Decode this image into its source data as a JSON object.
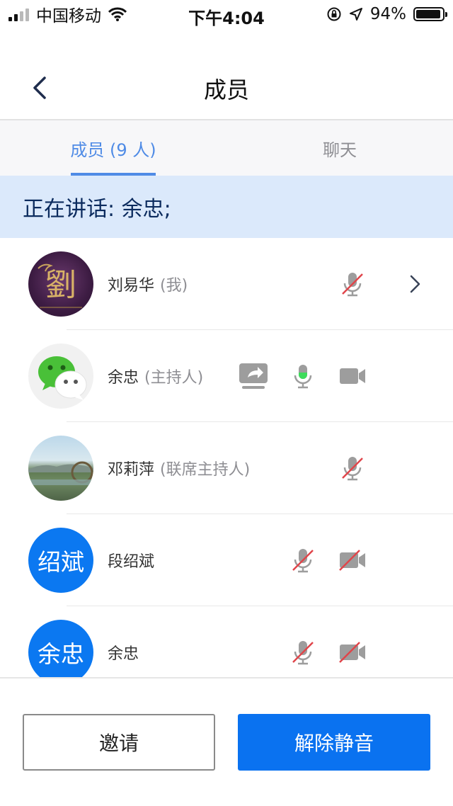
{
  "status_bar": {
    "carrier": "中国移动",
    "time": "下午4:04",
    "battery_percent": "94%",
    "signal_bars": 2,
    "signal_total": 4,
    "battery_fraction": 0.94
  },
  "nav": {
    "title": "成员"
  },
  "tabs": {
    "members": "成员 (9 人)",
    "chat": "聊天"
  },
  "banner": {
    "text": "正在讲话: 余忠;"
  },
  "members": [
    {
      "name": "刘易华",
      "role": "(我)",
      "avatar_text": ""
    },
    {
      "name": "余忠",
      "role": "(主持人)",
      "avatar_text": ""
    },
    {
      "name": "邓莉萍",
      "role": "(联席主持人)",
      "avatar_text": ""
    },
    {
      "name": "段绍斌",
      "role": "",
      "avatar_text": "绍斌"
    },
    {
      "name": "余忠",
      "role": "",
      "avatar_text": "余忠"
    }
  ],
  "buttons": {
    "invite": "邀请",
    "unmute": "解除静音"
  },
  "colors": {
    "accent": "#4f8be6",
    "primary_button": "#0a72f0",
    "banner_bg": "#dbe9fb",
    "avatar_blue": "#0b78f1",
    "mute_slash": "#e0454a",
    "mic_active": "#3ddc5b"
  }
}
